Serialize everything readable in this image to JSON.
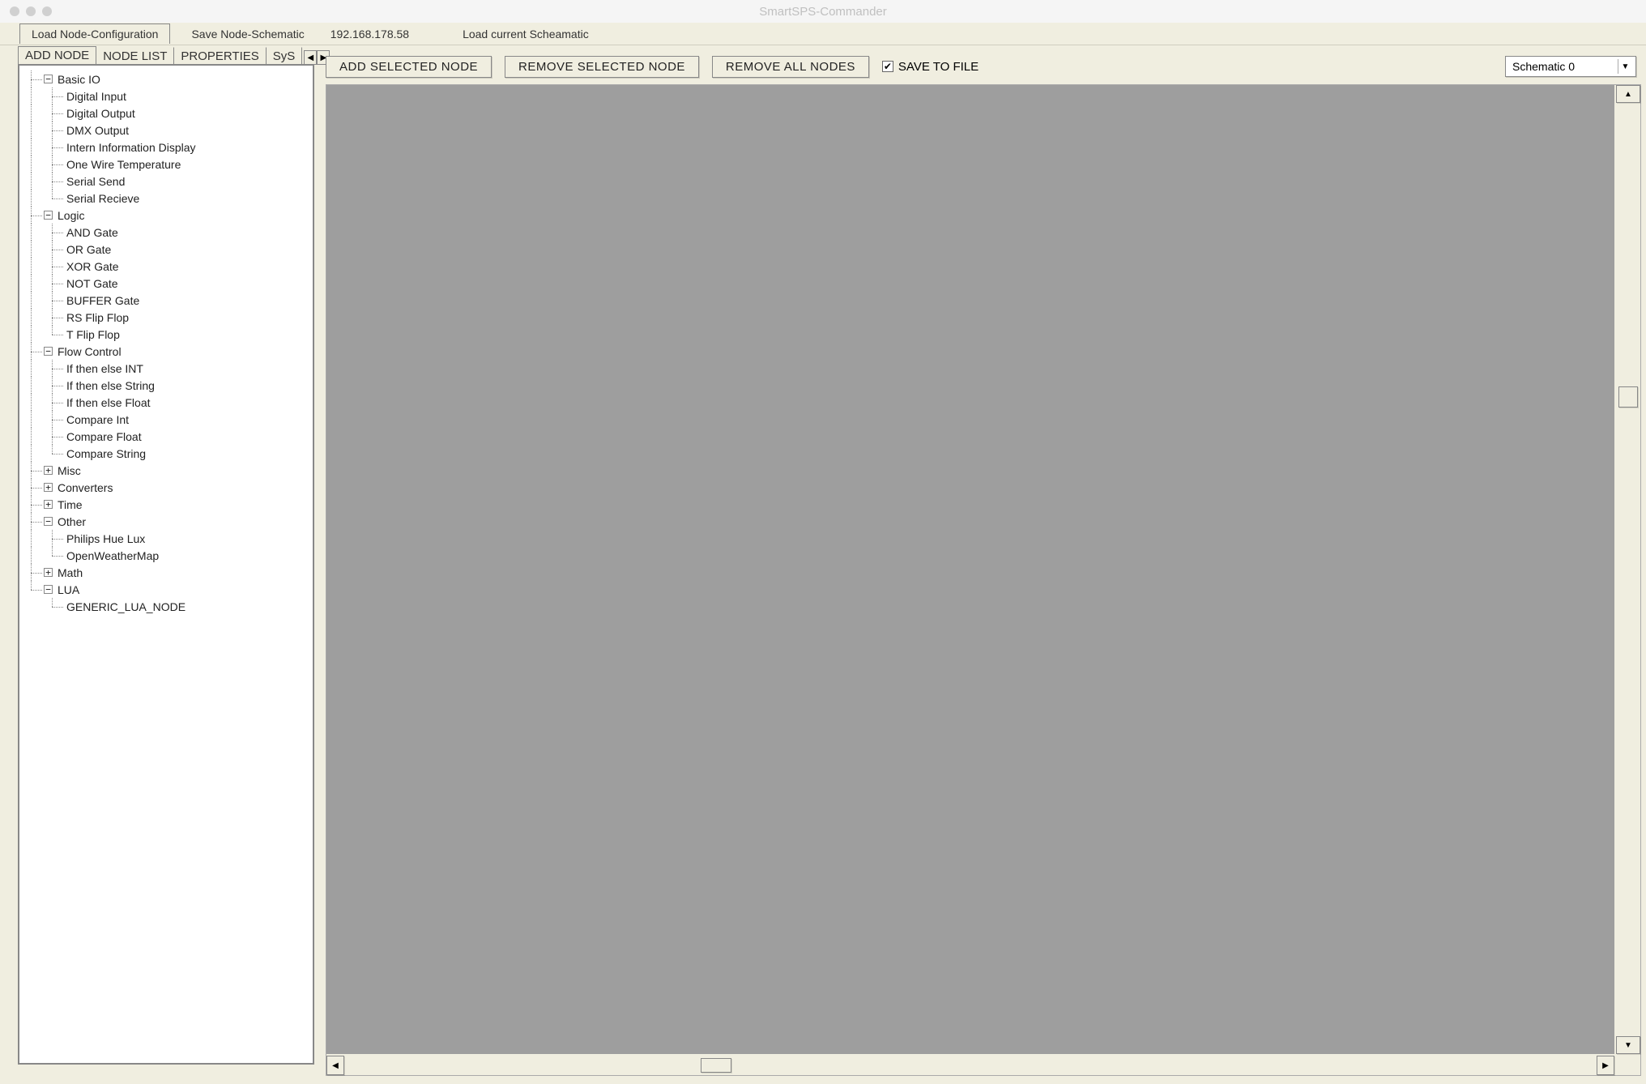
{
  "window": {
    "title": "SmartSPS-Commander"
  },
  "menubar": {
    "items": [
      {
        "label": "Load Node-Configuration",
        "boxed": true
      },
      {
        "label": "Save Node-Schematic",
        "boxed": false
      },
      {
        "label": "192.168.178.58",
        "boxed": false
      },
      {
        "label": "Load current Scheamatic",
        "boxed": false
      }
    ]
  },
  "tabs": {
    "items": [
      {
        "label": "ADD NODE",
        "selected": true
      },
      {
        "label": "NODE LIST",
        "selected": false
      },
      {
        "label": "PROPERTIES",
        "selected": false
      },
      {
        "label": "SyS",
        "selected": false,
        "truncated": true
      }
    ]
  },
  "toolbar": {
    "add": "ADD SELECTED NODE",
    "remove": "REMOVE SELECTED NODE",
    "removeAll": "REMOVE ALL NODES",
    "saveToFile": "SAVE TO FILE",
    "saveChecked": true,
    "schematicSelect": "Schematic 0"
  },
  "tree": [
    {
      "label": "Basic IO",
      "state": "open",
      "children": [
        {
          "label": "Digital Input"
        },
        {
          "label": "Digital Output"
        },
        {
          "label": "DMX Output"
        },
        {
          "label": "Intern Information Display"
        },
        {
          "label": "One Wire Temperature"
        },
        {
          "label": "Serial Send"
        },
        {
          "label": "Serial Recieve"
        }
      ]
    },
    {
      "label": "Logic",
      "state": "open",
      "children": [
        {
          "label": "AND Gate"
        },
        {
          "label": "OR Gate"
        },
        {
          "label": "XOR Gate"
        },
        {
          "label": "NOT Gate"
        },
        {
          "label": "BUFFER Gate"
        },
        {
          "label": "RS Flip Flop"
        },
        {
          "label": "T Flip Flop"
        }
      ]
    },
    {
      "label": "Flow Control",
      "state": "open",
      "children": [
        {
          "label": "If then else INT"
        },
        {
          "label": "If then else String"
        },
        {
          "label": "If then else Float"
        },
        {
          "label": "Compare Int"
        },
        {
          "label": "Compare Float"
        },
        {
          "label": "Compare String"
        }
      ]
    },
    {
      "label": "Misc",
      "state": "closed"
    },
    {
      "label": "Converters",
      "state": "closed"
    },
    {
      "label": "Time",
      "state": "closed"
    },
    {
      "label": "Other",
      "state": "open",
      "children": [
        {
          "label": "Philips Hue Lux"
        },
        {
          "label": "OpenWeatherMap"
        }
      ]
    },
    {
      "label": "Math",
      "state": "closed"
    },
    {
      "label": "LUA",
      "state": "open",
      "children": [
        {
          "label": "GENERIC_LUA_NODE"
        }
      ]
    }
  ]
}
